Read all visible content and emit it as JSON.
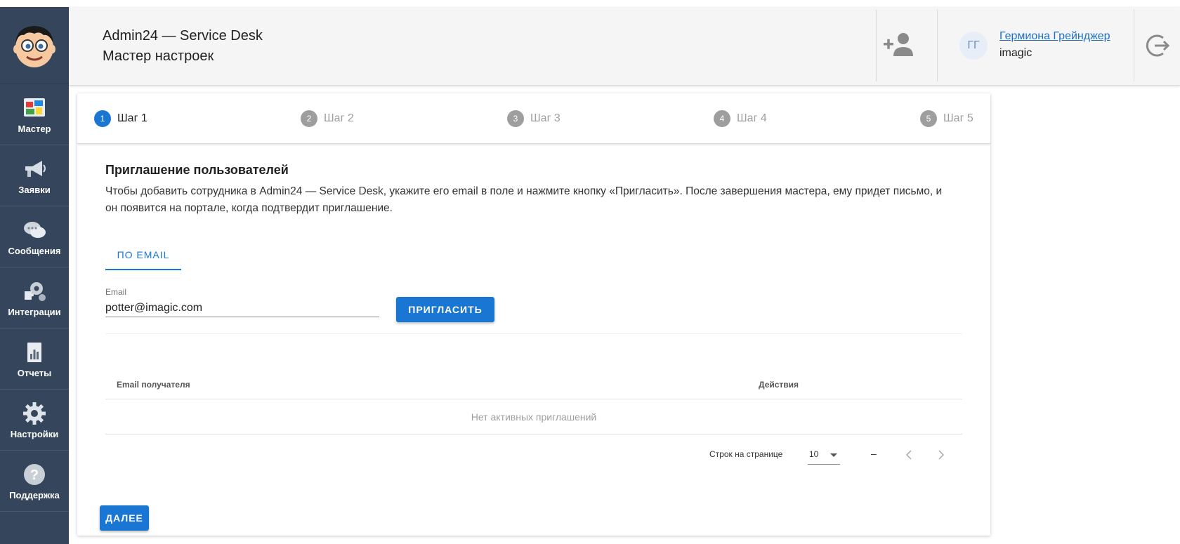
{
  "header": {
    "app_title": "Admin24 — Service Desk",
    "page_title": "Мастер настроек",
    "user": {
      "initials": "ГГ",
      "name": "Гермиона Грейнджер",
      "org": "imagic"
    }
  },
  "sidebar": {
    "items": [
      {
        "label": "Мастер",
        "icon": "wizard-icon"
      },
      {
        "label": "Заявки",
        "icon": "megaphone-icon"
      },
      {
        "label": "Сообщения",
        "icon": "chat-icon"
      },
      {
        "label": "Интеграции",
        "icon": "puzzle-gear-icon"
      },
      {
        "label": "Отчеты",
        "icon": "report-icon"
      },
      {
        "label": "Настройки",
        "icon": "gear-icon"
      },
      {
        "label": "Поддержка",
        "icon": "help-icon"
      }
    ]
  },
  "stepper": {
    "steps": [
      {
        "num": "1",
        "label": "Шаг 1",
        "active": true
      },
      {
        "num": "2",
        "label": "Шаг 2",
        "active": false
      },
      {
        "num": "3",
        "label": "Шаг 3",
        "active": false
      },
      {
        "num": "4",
        "label": "Шаг 4",
        "active": false
      },
      {
        "num": "5",
        "label": "Шаг 5",
        "active": false
      }
    ]
  },
  "invite": {
    "title": "Приглашение пользователей",
    "description": "Чтобы добавить сотрудника в Admin24 — Service Desk, укажите его email в поле и нажмите кнопку «Пригласить». После завершения мастера, ему придет письмо, и он появится на портале, когда подтвердит приглашение.",
    "tab_label": "ПО EMAIL",
    "email_label": "Email",
    "email_value": "potter@imagic.com",
    "invite_button": "ПРИГЛАСИТЬ"
  },
  "table": {
    "columns": [
      "Email получателя",
      "Действия"
    ],
    "empty_text": "Нет активных приглашений",
    "rows_per_page_label": "Строк на странице",
    "rows_per_page_value": "10",
    "range_text": "–"
  },
  "footer": {
    "next_button": "ДАЛЕЕ"
  },
  "colors": {
    "primary": "#1976d2",
    "sidebar": "#35465c",
    "header_bg": "#f5f5f5"
  }
}
